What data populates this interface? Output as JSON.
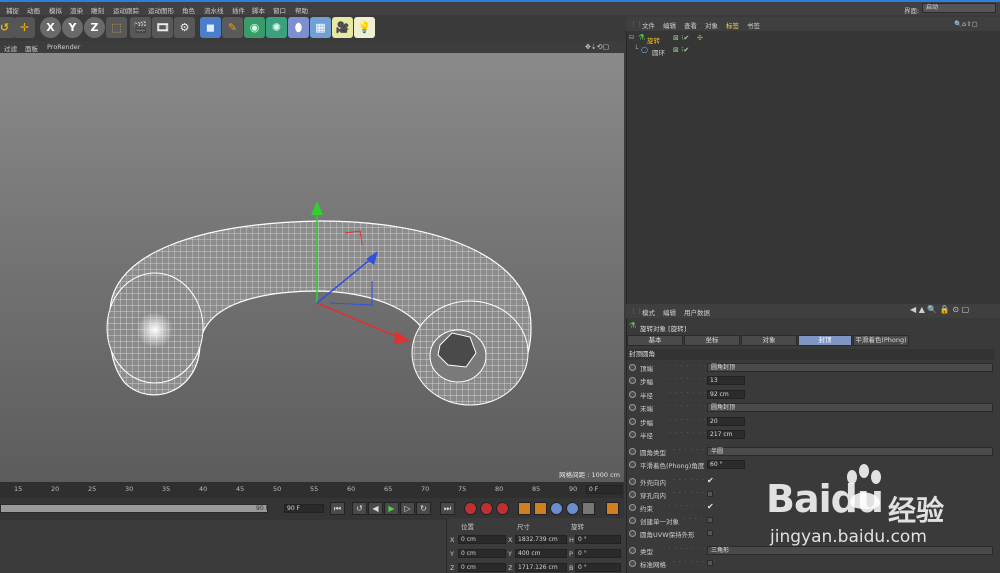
{
  "menubar": {
    "items": [
      "捕捉",
      "动画",
      "模拟",
      "渲染",
      "雕刻",
      "运动跟踪",
      "运动图形",
      "角色",
      "流水线",
      "插件",
      "脚本",
      "窗口",
      "帮助"
    ],
    "layout_label": "界面:",
    "layout_value": "启动"
  },
  "toolbar": {
    "axis_x": "X",
    "axis_y": "Y",
    "axis_z": "Z"
  },
  "viewport": {
    "menu": [
      "过滤",
      "面板",
      "ProRender"
    ],
    "grid_label": "网格间距 : 1000 cm"
  },
  "timeline": {
    "ticks": [
      "15",
      "20",
      "25",
      "30",
      "35",
      "40",
      "45",
      "50",
      "55",
      "60",
      "65",
      "70",
      "75",
      "80",
      "85",
      "90"
    ],
    "frame_field": "0 F",
    "end_frame": "90 F",
    "end_frame_field": "90 F"
  },
  "coords": {
    "headers": [
      "位置",
      "尺寸",
      "旋转"
    ],
    "rows": [
      {
        "axis": "X",
        "pos": "0 cm",
        "size_axis": "X",
        "size": "1832.739 cm",
        "rot_axis": "H",
        "rot": "0 °"
      },
      {
        "axis": "Y",
        "pos": "0 cm",
        "size_axis": "Y",
        "size": "400 cm",
        "rot_axis": "P",
        "rot": "0 °"
      },
      {
        "axis": "Z",
        "pos": "0 cm",
        "size_axis": "Z",
        "size": "1717.126 cm",
        "rot_axis": "B",
        "rot": "0 °"
      }
    ]
  },
  "object_manager": {
    "menu": [
      "文件",
      "编辑",
      "查看",
      "对象",
      "标签",
      "书签"
    ],
    "objects": [
      {
        "name": "旋转"
      },
      {
        "name": "圆环"
      }
    ]
  },
  "attributes": {
    "menu": [
      "模式",
      "编辑",
      "用户数据"
    ],
    "title": "旋转对象 [旋转]",
    "tabs": [
      {
        "label": "基本",
        "active": false
      },
      {
        "label": "坐标",
        "active": false
      },
      {
        "label": "对象",
        "active": false
      },
      {
        "label": "封顶",
        "active": true
      },
      {
        "label": "平滑着色(Phong)",
        "active": false
      }
    ],
    "section": "封顶圆角",
    "rows": [
      {
        "label": "顶端",
        "type": "dropdown",
        "value": "圆角封顶"
      },
      {
        "label": "步幅",
        "type": "number",
        "value": "13"
      },
      {
        "label": "半径",
        "type": "number",
        "value": "92 cm"
      },
      {
        "label": "末端",
        "type": "dropdown",
        "value": "圆角封顶"
      },
      {
        "label": "步幅",
        "type": "number",
        "value": "20"
      },
      {
        "label": "半径",
        "type": "number",
        "value": "217 cm"
      },
      {
        "label": "圆角类型",
        "type": "dropdown",
        "value": "半圆"
      },
      {
        "label": "平滑着色(Phong)角度",
        "type": "number",
        "value": "60 °"
      },
      {
        "label": "外壳向内",
        "type": "check",
        "value": "✔"
      },
      {
        "label": "穿孔向内",
        "type": "box",
        "value": ""
      },
      {
        "label": "约束",
        "type": "check",
        "value": "✔"
      },
      {
        "label": "创建单一对象",
        "type": "box",
        "value": ""
      },
      {
        "label": "圆角UVW保持外形",
        "type": "box",
        "value": ""
      },
      {
        "label": "类型",
        "type": "dropdown",
        "value": "三角形"
      },
      {
        "label": "标准网格",
        "type": "box",
        "value": ""
      }
    ]
  },
  "watermark": {
    "brand": "Baidu",
    "brand_cn": "经验",
    "url": "jingyan.baidu.com"
  }
}
